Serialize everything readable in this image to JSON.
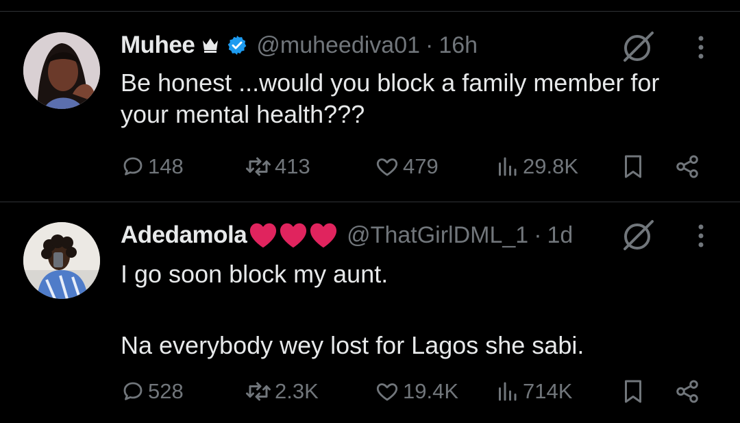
{
  "tweets": [
    {
      "author_name": "Muhee",
      "handle": "@muheediva01",
      "separator": "·",
      "time": "16h",
      "text": "Be honest ...would you block a family member for\nyour mental health???",
      "badges": [
        "crown-icon",
        "verified-icon"
      ],
      "stats": {
        "replies": "148",
        "reposts": "413",
        "likes": "479",
        "views": "29.8K"
      }
    },
    {
      "author_name": "Adedamola",
      "name_emojis": "❤️❤️❤️",
      "handle": "@ThatGirlDML_1",
      "separator": "·",
      "time": "1d",
      "text": "I go soon block my aunt.\n\nNa everybody wey lost for Lagos she sabi.",
      "stats": {
        "replies": "528",
        "reposts": "2.3K",
        "likes": "19.4K",
        "views": "714K"
      }
    }
  ],
  "colors": {
    "background": "#000000",
    "text": "#e7e9ea",
    "muted": "#71767b",
    "verified": "#1d9bf0",
    "divider": "#2f3336",
    "heart": "#e0245e"
  }
}
